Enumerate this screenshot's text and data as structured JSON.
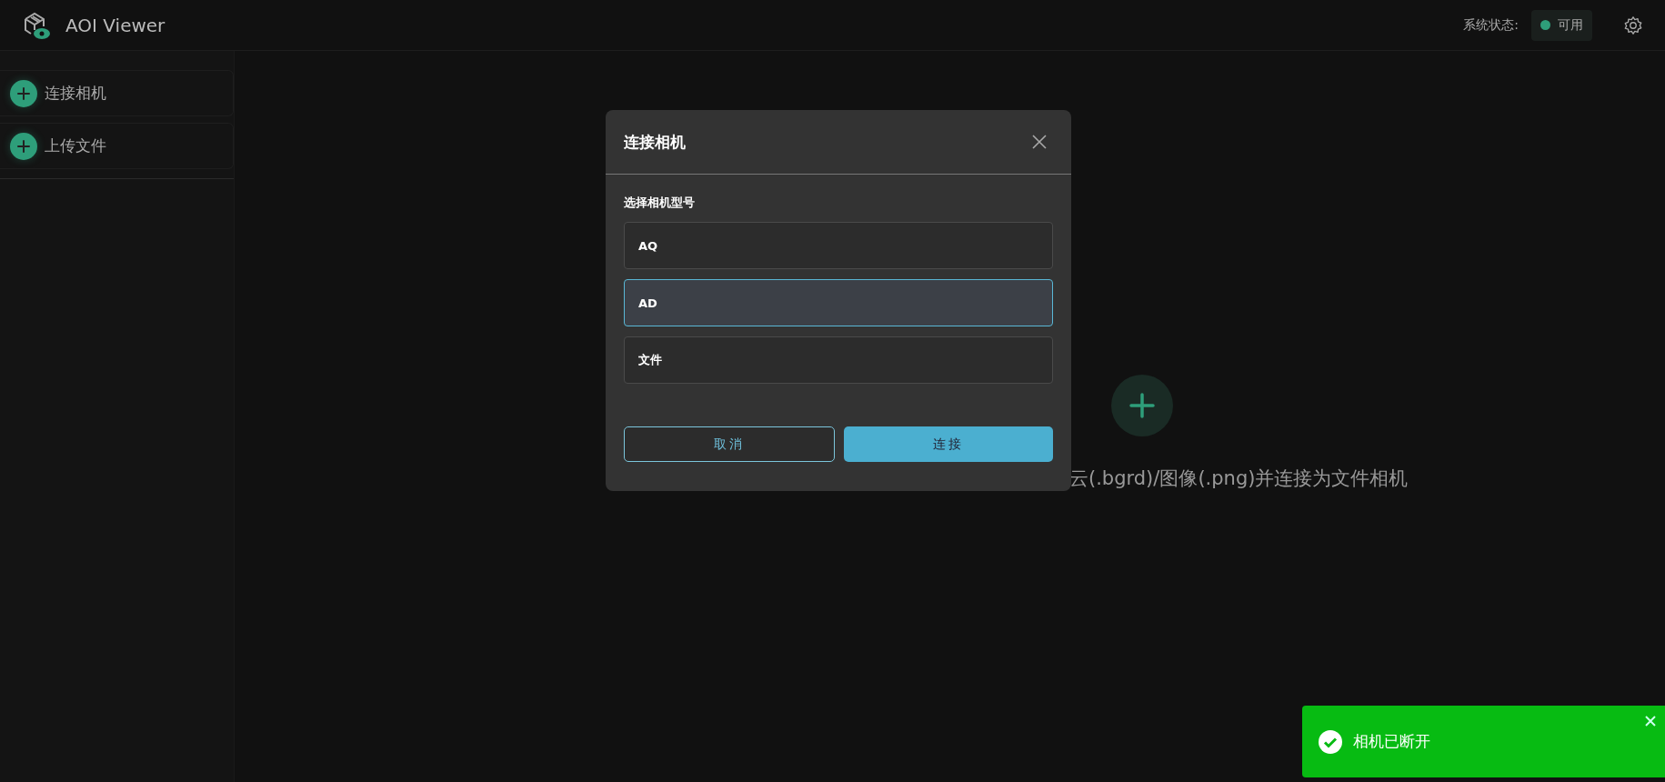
{
  "app": {
    "title": "AOI Viewer"
  },
  "status": {
    "label": "系统状态:",
    "value": "可用"
  },
  "sidebar": {
    "items": [
      {
        "label": "连接相机"
      },
      {
        "label": "上传文件"
      }
    ]
  },
  "empty_state": {
    "text": "云(.bgrd)/图像(.png)并连接为文件相机"
  },
  "dialog": {
    "title": "连接相机",
    "section_label": "选择相机型号",
    "options": [
      {
        "label": "AQ",
        "selected": false
      },
      {
        "label": "AD",
        "selected": true
      },
      {
        "label": "文件",
        "selected": false
      }
    ],
    "buttons": [
      {
        "label": "取消",
        "kind": "secondary"
      },
      {
        "label": "连接",
        "kind": "primary"
      }
    ]
  },
  "toast": {
    "message": "相机已断开"
  }
}
